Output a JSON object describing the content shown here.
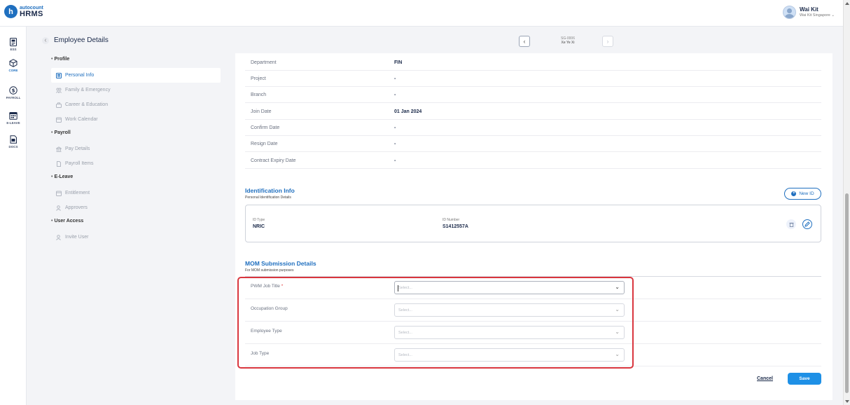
{
  "app": {
    "logo_mark": "h",
    "logo_top": "autocount",
    "logo_bottom": "HRMS"
  },
  "user": {
    "name": "Wai Kit",
    "company": "Wai Kit Singapore"
  },
  "rail": [
    {
      "label": "ESS",
      "icon": "ess-icon"
    },
    {
      "label": "CORE",
      "icon": "core-icon"
    },
    {
      "label": "PAYROLL",
      "icon": "payroll-icon"
    },
    {
      "label": "E-LEAVE",
      "icon": "calendar-icon"
    },
    {
      "label": "DOCS",
      "icon": "docs-icon"
    }
  ],
  "page": {
    "title": "Employee Details",
    "employee_code": "SG-0006",
    "employee_name": "Xe Ye Xi"
  },
  "menu": {
    "profile": "Profile",
    "personal_info": "Personal Info",
    "family": "Family & Emergency",
    "career": "Career & Education",
    "work_calendar": "Work Calendar",
    "payroll": "Payroll",
    "pay_details": "Pay Details",
    "payroll_items": "Payroll Items",
    "eleave": "E-Leave",
    "entitlement": "Entitlement",
    "approvers": "Approvers",
    "user_access": "User Access",
    "invite_user": "Invite User"
  },
  "employment": [
    {
      "label": "Department",
      "value": "FIN"
    },
    {
      "label": "Project",
      "value": "-"
    },
    {
      "label": "Branch",
      "value": "-"
    },
    {
      "label": "Join Date",
      "value": "01 Jan 2024"
    },
    {
      "label": "Confirm Date",
      "value": "-"
    },
    {
      "label": "Resign Date",
      "value": "-"
    },
    {
      "label": "Contract Expiry Date",
      "value": "-"
    }
  ],
  "identification": {
    "title": "Identification Info",
    "subtitle": "Personal Identification Details",
    "new_id_label": "New ID",
    "id_type_label": "ID Type",
    "id_type_value": "NRIC",
    "id_number_label": "ID Number",
    "id_number_value": "S1412557A"
  },
  "mom": {
    "title": "MOM Submission Details",
    "subtitle": "For MOM submission purposes",
    "fields": [
      {
        "label": "PWM Job Title",
        "required": "*",
        "placeholder": "Select..."
      },
      {
        "label": "Occupation Group",
        "placeholder": "Select..."
      },
      {
        "label": "Employee Type",
        "placeholder": "Select..."
      },
      {
        "label": "Job Type",
        "placeholder": "Select..."
      }
    ]
  },
  "actions": {
    "cancel": "Cancel",
    "save": "Save"
  },
  "colors": {
    "brand": "#1f6fbf",
    "save_button": "#1e90e6",
    "highlight_border": "#d9363e"
  }
}
